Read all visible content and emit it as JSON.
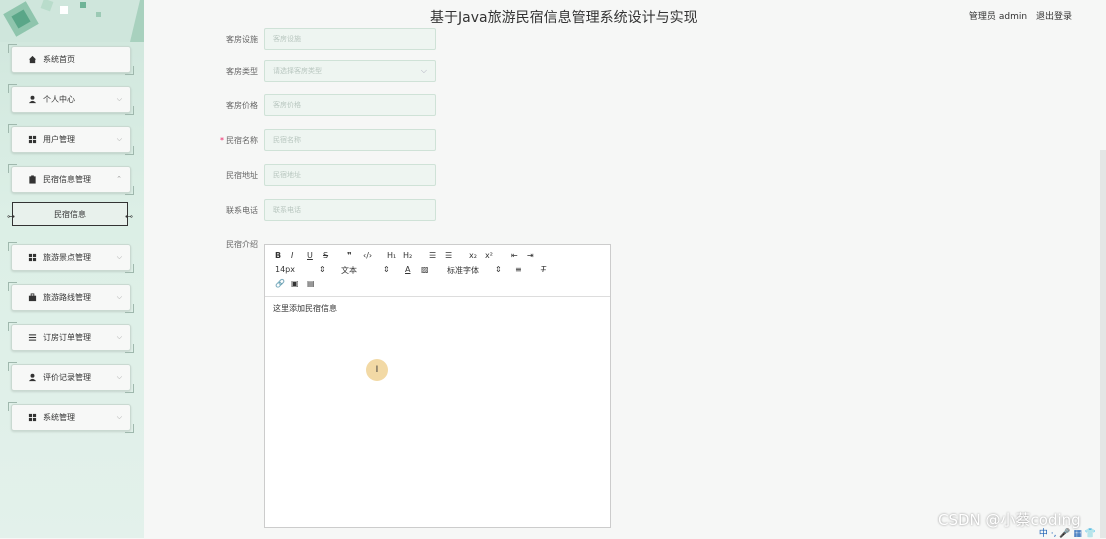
{
  "header": {
    "title": "基于Java旅游民宿信息管理系统设计与实现",
    "user_role": "管理员",
    "username": "admin",
    "logout": "退出登录"
  },
  "sidebar": {
    "items": [
      {
        "label": "系统首页",
        "icon": "home-icon"
      },
      {
        "label": "个人中心",
        "icon": "user-icon"
      },
      {
        "label": "用户管理",
        "icon": "grid-icon"
      },
      {
        "label": "民宿信息管理",
        "icon": "clipboard-icon"
      },
      {
        "label": "旅游景点管理",
        "icon": "grid-icon"
      },
      {
        "label": "旅游路线管理",
        "icon": "briefcase-icon"
      },
      {
        "label": "订房订单管理",
        "icon": "list-icon"
      },
      {
        "label": "评价记录管理",
        "icon": "user-icon"
      },
      {
        "label": "系统管理",
        "icon": "grid-icon"
      }
    ],
    "sub_item": "民宿信息"
  },
  "form": {
    "room_facility": {
      "label": "客房设施",
      "placeholder": "客房设施"
    },
    "room_type": {
      "label": "客房类型",
      "placeholder": "请选择客房类型"
    },
    "room_price": {
      "label": "客房价格",
      "placeholder": "客房价格"
    },
    "homestay_name": {
      "label": "民宿名称",
      "placeholder": "民宿名称",
      "required": "*"
    },
    "homestay_address": {
      "label": "民宿地址",
      "placeholder": "民宿地址"
    },
    "contact_phone": {
      "label": "联系电话",
      "placeholder": "联系电话"
    },
    "homestay_intro": {
      "label": "民宿介绍"
    }
  },
  "editor": {
    "font_size": "14px",
    "text_style": "文本",
    "font_family": "标准字体",
    "content": "这里添加民宿信息"
  },
  "watermark": "CSDN @小蔡coding",
  "tray": "中 ·, 🎤 ▦ 👕"
}
